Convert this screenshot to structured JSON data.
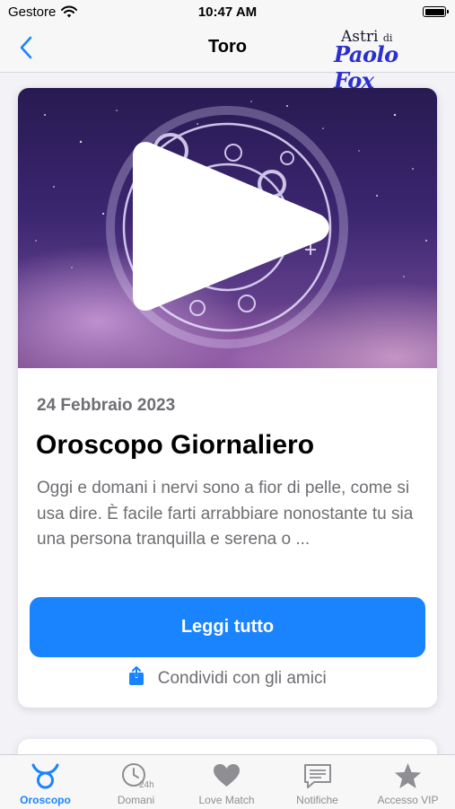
{
  "status_bar": {
    "carrier": "Gestore",
    "time": "10:47 AM"
  },
  "nav": {
    "title": "Toro",
    "logo_line1": "Astri",
    "logo_line1_small": "di",
    "logo_line2": "Paolo Fox"
  },
  "card": {
    "date": "24 Febbraio 2023",
    "title": "Oroscopo Giornaliero",
    "excerpt": "Oggi e domani i nervi sono a fior di pelle, come si usa dire. È facile farti arrabbiare nonostante tu sia una persona tranquilla e serena o ...",
    "read_button": "Leggi tutto",
    "share_label": "Condividi con gli amici"
  },
  "tabs": [
    {
      "label": "Oroscopo",
      "icon": "taurus-icon",
      "active": true
    },
    {
      "label": "Domani",
      "icon": "clock-24h-icon",
      "active": false
    },
    {
      "label": "Love Match",
      "icon": "heart-icon",
      "active": false
    },
    {
      "label": "Notifiche",
      "icon": "message-icon",
      "active": false
    },
    {
      "label": "Accesso VIP",
      "icon": "star-icon",
      "active": false
    }
  ],
  "colors": {
    "accent": "#1a84ff",
    "inactive": "#8e8e93",
    "background": "#f2f2f7"
  }
}
